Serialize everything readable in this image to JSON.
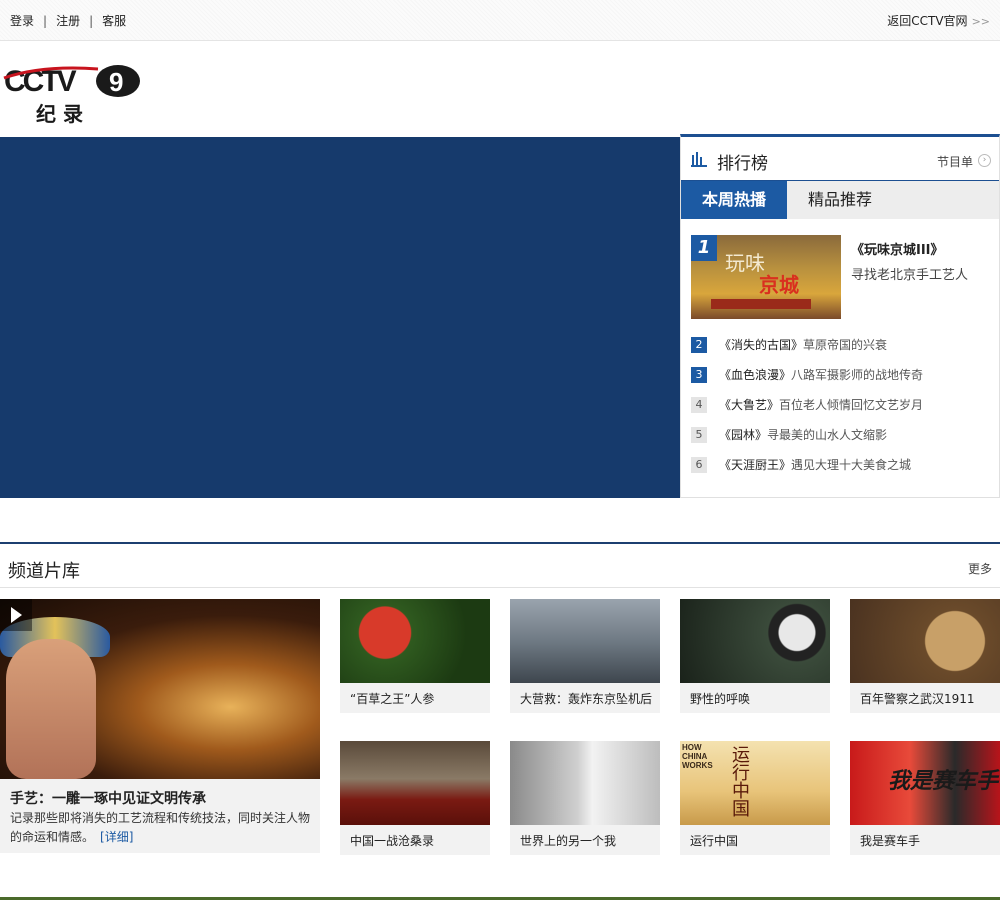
{
  "topbar": {
    "login": "登录",
    "register": "注册",
    "service": "客服",
    "back": "返回CCTV官网",
    "back_arrow": ">>"
  },
  "logo": {
    "name": "CCTV9",
    "sub": "纪 录"
  },
  "ranking": {
    "title": "排行榜",
    "more": "节目单",
    "tabs": [
      "本周热播",
      "精品推荐"
    ],
    "top1": {
      "num": "1",
      "name": "《玩味京城III》",
      "desc": "寻找老北京手工艺人",
      "thumb_text1": "玩味",
      "thumb_text2": "京城"
    },
    "items": [
      {
        "num": "2",
        "name": "《消失的古国》",
        "desc": "草原帝国的兴衰"
      },
      {
        "num": "3",
        "name": "《血色浪漫》",
        "desc": "八路军摄影师的战地传奇"
      },
      {
        "num": "4",
        "name": "《大鲁艺》",
        "desc": "百位老人倾情回忆文艺岁月"
      },
      {
        "num": "5",
        "name": "《园林》",
        "desc": "寻最美的山水人文缩影"
      },
      {
        "num": "6",
        "name": "《天涯厨王》",
        "desc": "遇见大理十大美食之城"
      }
    ]
  },
  "library": {
    "title": "频道片库",
    "more": "更多",
    "feature": {
      "title": "手艺：一雕一琢中见证文明传承",
      "desc": "记录那些即将消失的工艺流程和传统技法，同时关注人物的命运和情感。",
      "detail": "[详细]"
    },
    "cards": [
      "“百草之王”人参",
      "大营救：轰炸东京坠机后",
      "野性的呼唤",
      "百年警察之武汉1911",
      "中国一战沧桑录",
      "世界上的另一个我",
      "运行中国",
      "我是赛车手"
    ],
    "thumb_texts": {
      "china_works": "HOW CHINA WORKS",
      "yunxing": "运行中国",
      "racer": "我是赛车手"
    }
  },
  "colors": {
    "navy": "#163a6c",
    "accent_blue": "#1c5aa3",
    "footer_green": "#4a6a2a"
  }
}
